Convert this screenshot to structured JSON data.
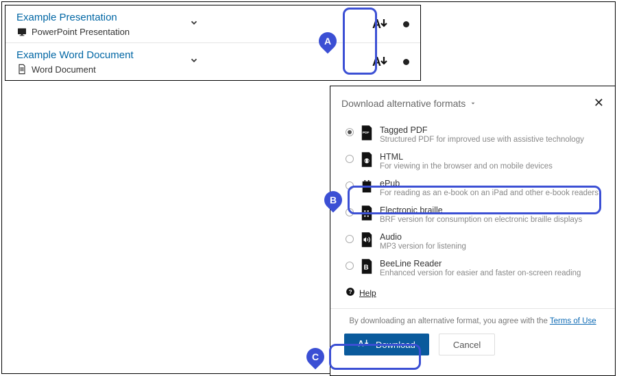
{
  "file_list": {
    "rows": [
      {
        "title": "Example Presentation",
        "subtitle": "PowerPoint Presentation",
        "subicon": "ppt-icon"
      },
      {
        "title": "Example Word Document",
        "subtitle": "Word Document",
        "subicon": "doc-icon"
      }
    ]
  },
  "modal": {
    "title": "Download alternative formats",
    "formats": [
      {
        "name": "Tagged PDF",
        "desc": "Structured PDF for improved use with assistive technology",
        "icon": "pdf-icon",
        "selected": true
      },
      {
        "name": "HTML",
        "desc": "For viewing in the browser and on mobile devices",
        "icon": "html-icon",
        "selected": false
      },
      {
        "name": "ePub",
        "desc": "For reading as an e-book on an iPad and other e-book readers",
        "icon": "epub-icon",
        "selected": false
      },
      {
        "name": "Electronic braille",
        "desc": "BRF version for consumption on electronic braille displays",
        "icon": "braille-icon",
        "selected": false
      },
      {
        "name": "Audio",
        "desc": "MP3 version for listening",
        "icon": "audio-icon",
        "selected": false
      },
      {
        "name": "BeeLine Reader",
        "desc": "Enhanced version for easier and faster on-screen reading",
        "icon": "beeline-icon",
        "selected": false
      }
    ],
    "help_label": "Help",
    "terms_prefix": "By downloading an alternative format, you agree with the ",
    "terms_link": "Terms of Use",
    "download_label": "Download",
    "cancel_label": "Cancel"
  },
  "callouts": {
    "A": "A",
    "B": "B",
    "C": "C"
  }
}
